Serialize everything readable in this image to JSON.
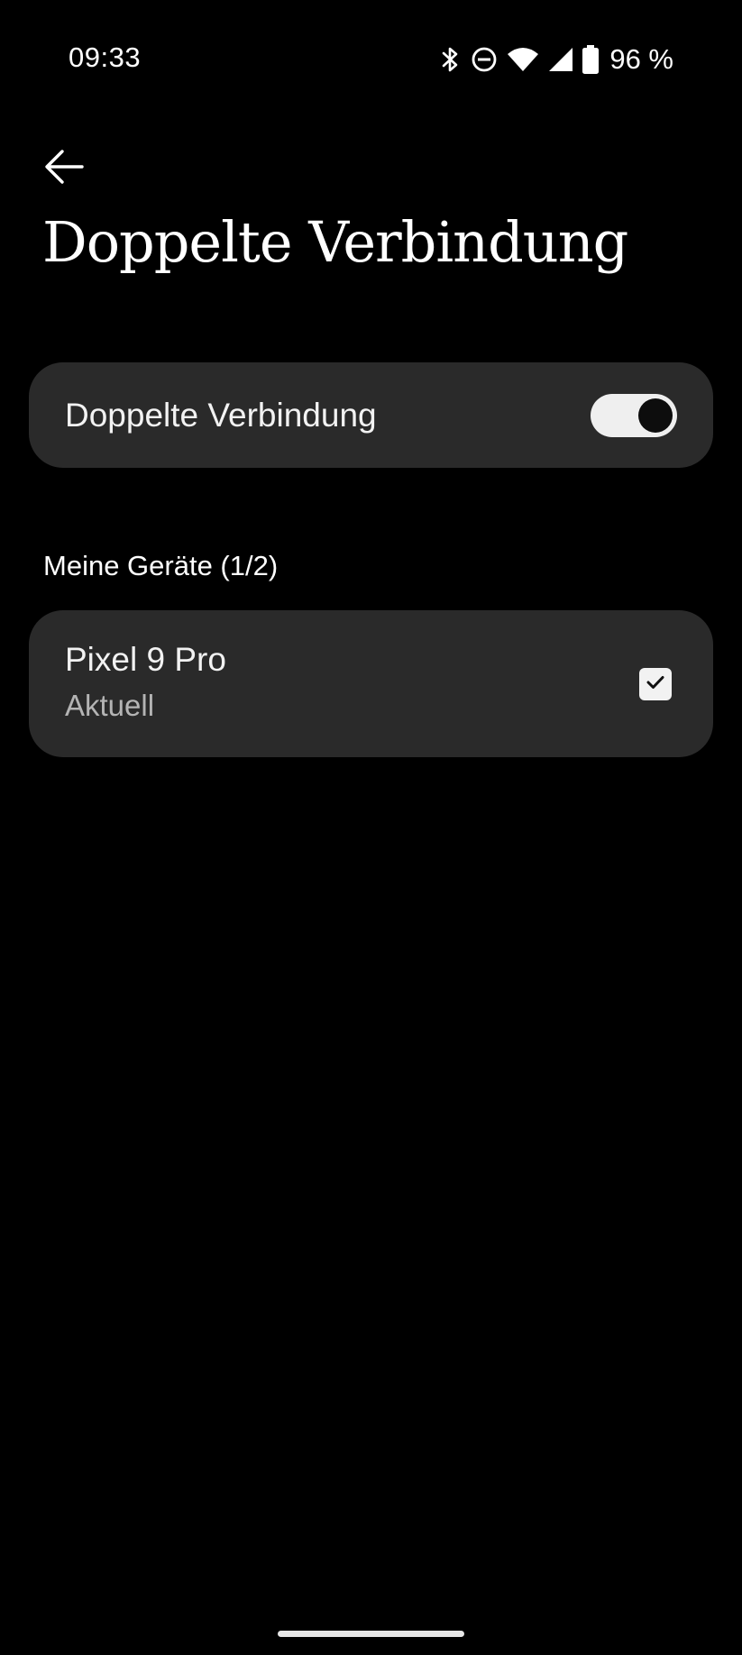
{
  "status_bar": {
    "time": "09:33",
    "battery_percent": "96 %",
    "icons": [
      "bluetooth-icon",
      "do-not-disturb-icon",
      "wifi-icon",
      "cellular-signal-icon",
      "battery-icon"
    ]
  },
  "header": {
    "back_icon": "arrow-left-icon",
    "title": "Doppelte Verbindung"
  },
  "dual_connection": {
    "label": "Doppelte Verbindung",
    "enabled": true
  },
  "my_devices": {
    "header": "Meine Geräte (1/2)",
    "devices": [
      {
        "name": "Pixel 9 Pro",
        "status": "Aktuell",
        "checked": true
      }
    ]
  },
  "colors": {
    "background": "#000000",
    "card": "#2a2a2a",
    "toggle_track": "#efefef",
    "secondary_text": "#b4b4b4"
  }
}
